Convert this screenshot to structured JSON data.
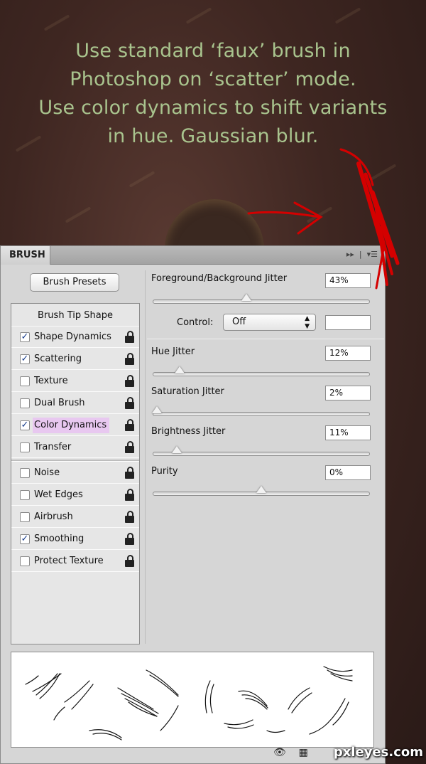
{
  "caption": {
    "line1": "Use standard ‘faux’ brush in",
    "line2": "Photoshop on ‘scatter’ mode.",
    "line3": "Use color dynamics to shift variants",
    "line4": "in hue. Gaussian blur."
  },
  "panel": {
    "tab_label": "BRUSH",
    "presets_button": "Brush Presets",
    "list": {
      "header": "Brush Tip Shape",
      "items": [
        {
          "label": "Shape Dynamics",
          "checked": true
        },
        {
          "label": "Scattering",
          "checked": true
        },
        {
          "label": "Texture",
          "checked": false
        },
        {
          "label": "Dual Brush",
          "checked": false
        },
        {
          "label": "Color Dynamics",
          "checked": true,
          "selected": true
        },
        {
          "label": "Transfer",
          "checked": false
        },
        {
          "label": "Noise",
          "checked": false
        },
        {
          "label": "Wet Edges",
          "checked": false
        },
        {
          "label": "Airbrush",
          "checked": false
        },
        {
          "label": "Smoothing",
          "checked": true
        },
        {
          "label": "Protect Texture",
          "checked": false
        }
      ]
    },
    "settings": {
      "fg_bg_jitter": {
        "label": "Foreground/Background Jitter",
        "value": "43%",
        "level": 0.43
      },
      "control": {
        "label": "Control:",
        "value": "Off"
      },
      "hue_jitter": {
        "label": "Hue Jitter",
        "value": "12%",
        "level": 0.12
      },
      "saturation_jitter": {
        "label": "Saturation Jitter",
        "value": "2%",
        "level": 0.02
      },
      "brightness_jitter": {
        "label": "Brightness Jitter",
        "value": "11%",
        "level": 0.11
      },
      "purity": {
        "label": "Purity",
        "value": "0%",
        "level": 0.5
      }
    }
  },
  "watermark": "pxleyes.com",
  "colors": {
    "caption": "#a9c48e",
    "selected_highlight": "#e8c8f0",
    "annotation": "#d40000"
  }
}
